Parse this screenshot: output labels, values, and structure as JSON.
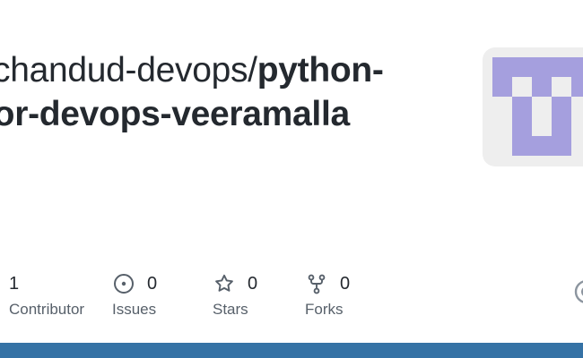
{
  "repo": {
    "owner": "chandud-devops/",
    "name_line1": "python-",
    "name_line2": "for-devops-veeramalla"
  },
  "avatar": {
    "icon": "identicon",
    "color": "#a59fde",
    "background": "#eeeeee"
  },
  "stats": [
    {
      "count": "1",
      "label": "Contributor",
      "icon": "people-icon"
    },
    {
      "count": "0",
      "label": "Issues",
      "icon": "issue-opened-icon"
    },
    {
      "count": "0",
      "label": "Stars",
      "icon": "star-icon"
    },
    {
      "count": "0",
      "label": "Forks",
      "icon": "repo-forked-icon"
    }
  ],
  "colors": {
    "title_text": "#24292f",
    "muted_text": "#57606a",
    "bottom_bar": "#3572a5"
  }
}
